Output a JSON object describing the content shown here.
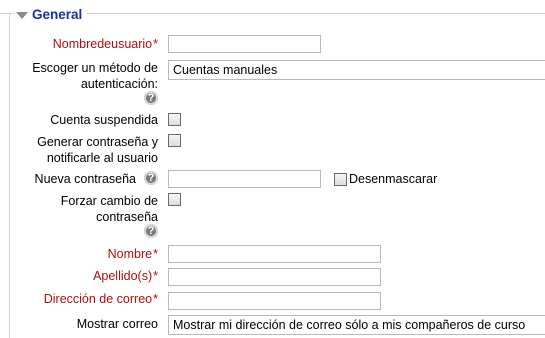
{
  "section": {
    "title": "General"
  },
  "fields": {
    "username": {
      "label": "Nombredeusuario",
      "required_mark": "*",
      "value": ""
    },
    "auth": {
      "label_line1": "Escoger un método de",
      "label_line2": "autenticación:",
      "value": "Cuentas manuales"
    },
    "suspended": {
      "label": "Cuenta suspendida"
    },
    "generate_password": {
      "label_line1": "Generar contraseña y",
      "label_line2": "notificarle al usuario"
    },
    "new_password": {
      "label": "Nueva contraseña",
      "value": "",
      "unmask_label": "Desenmascarar"
    },
    "force_change": {
      "label_line1": "Forzar cambio de",
      "label_line2": "contraseña"
    },
    "firstname": {
      "label": "Nombre",
      "required_mark": "*",
      "value": ""
    },
    "lastname": {
      "label": "Apellido(s)",
      "required_mark": "*",
      "value": ""
    },
    "email": {
      "label": "Dirección de correo",
      "required_mark": "*",
      "value": ""
    },
    "maildisplay": {
      "label": "Mostrar correo",
      "value": "Mostrar mi dirección de correo sólo a mis compañeros de curso"
    }
  },
  "icons": {
    "help": "question-circle-icon",
    "collapse": "triangle-down-icon"
  },
  "colors": {
    "required_label": "#aa1111",
    "legend": "#1a2fa0"
  }
}
